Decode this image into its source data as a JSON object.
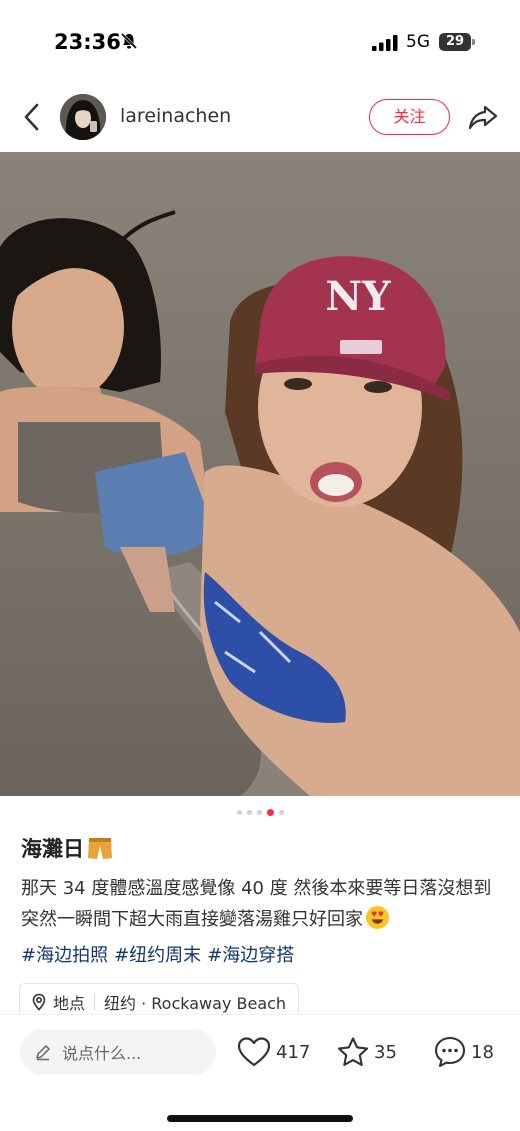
{
  "status_bar": {
    "time": "23:36",
    "network": "5G",
    "battery": "29"
  },
  "header": {
    "username": "lareinachen",
    "follow_label": "关注",
    "icons": [
      "back-icon",
      "avatar",
      "share-icon"
    ]
  },
  "carousel": {
    "total": 5,
    "active_index": 3
  },
  "post": {
    "title": "海灘日",
    "title_icon": "shorts-icon",
    "body": "那天 34 度體感溫度感覺像 40 度 然後本來要等日落沒想到突然一瞬間下超大雨直接變落湯雞只好回家",
    "body_icon": "heart-eyes-emoji-icon",
    "hashtags": [
      "#海边拍照",
      "#纽约周末",
      "#海边穿搭"
    ],
    "location": {
      "label": "地点",
      "value": "纽约 · Rockaway Beach"
    }
  },
  "bottom_bar": {
    "comment_placeholder": "说点什么...",
    "likes": "417",
    "collects": "35",
    "comments": "18"
  },
  "colors": {
    "accent": "#ff2741",
    "hashtag": "#13386c"
  }
}
